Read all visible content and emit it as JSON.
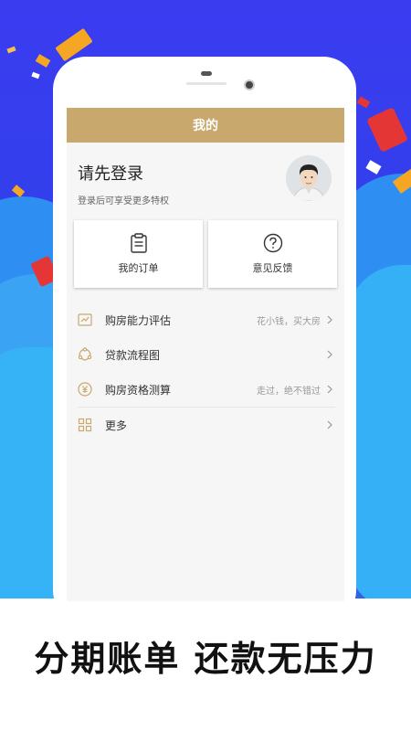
{
  "app": {
    "page_title": "我的"
  },
  "profile": {
    "title": "请先登录",
    "subtitle": "登录后可享受更多特权"
  },
  "cards": [
    {
      "label": "我的订单",
      "icon": "clipboard-icon"
    },
    {
      "label": "意见反馈",
      "icon": "question-circle-icon"
    }
  ],
  "menu": [
    {
      "label": "购房能力评估",
      "hint": "花小钱，买大房",
      "icon": "chart-card-icon"
    },
    {
      "label": "贷款流程图",
      "hint": "",
      "icon": "flow-icon"
    },
    {
      "label": "购房资格测算",
      "hint": "走过，绝不错过",
      "icon": "yuan-coin-icon"
    },
    {
      "label": "更多",
      "hint": "",
      "icon": "grid-icon"
    }
  ],
  "tagline": "分期账单  还款无压力",
  "colors": {
    "accent": "#c8a86c",
    "background_top": "#3a3cf0",
    "cloud": "#36b2f6"
  }
}
